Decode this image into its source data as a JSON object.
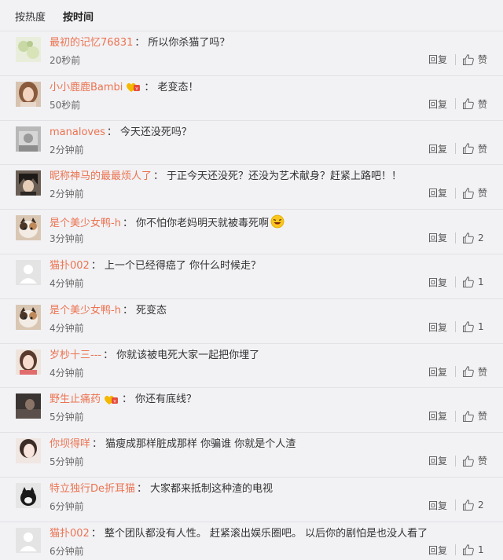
{
  "tabs": [
    {
      "label": "按热度",
      "active": false
    },
    {
      "label": "按时间",
      "active": true
    }
  ],
  "reply_label": "回复",
  "comments": [
    {
      "user": "最初的记忆76831",
      "text": "所以你杀猫了吗？",
      "time": "20秒前",
      "like": "赞",
      "badge": false,
      "emoji": false,
      "avatar": "watercolor"
    },
    {
      "user": "小小鹿鹿Bambi",
      "text": "老变态！",
      "time": "50秒前",
      "like": "赞",
      "badge": true,
      "emoji": false,
      "avatar": "girl-brown-hair"
    },
    {
      "user": "manaloves",
      "text": "今天还没死吗？",
      "time": "2分钟前",
      "like": "赞",
      "badge": false,
      "emoji": false,
      "avatar": "gray-photo"
    },
    {
      "user": "昵称神马的最最烦人了",
      "text": "于正今天还没死？还没为艺术献身？赶紧上路吧！！",
      "time": "2分钟前",
      "like": "赞",
      "badge": false,
      "emoji": false,
      "avatar": "dark-hair-boy"
    },
    {
      "user": "是个美少女鸭-h",
      "text": "你不怕你老妈明天就被毒死啊",
      "time": "3分钟前",
      "like": "2",
      "badge": false,
      "emoji": true,
      "avatar": "cat"
    },
    {
      "user": "猫扑002",
      "text": "上一个已经得癌了  你什么时候走？",
      "time": "4分钟前",
      "like": "1",
      "badge": false,
      "emoji": false,
      "avatar": "default"
    },
    {
      "user": "是个美少女鸭-h",
      "text": "死变态",
      "time": "4分钟前",
      "like": "1",
      "badge": false,
      "emoji": false,
      "avatar": "cat"
    },
    {
      "user": "岁杪十三---",
      "text": "你就该被电死大家一起把你埋了",
      "time": "4分钟前",
      "like": "赞",
      "badge": false,
      "emoji": false,
      "avatar": "girl-light"
    },
    {
      "user": "野生止痛药",
      "text": "你还有底线？",
      "time": "5分钟前",
      "like": "赞",
      "badge": true,
      "emoji": false,
      "avatar": "dark-scene"
    },
    {
      "user": "你坝得咩",
      "text": "猫瘦成那样脏成那样  你骗谁  你就是个人渣",
      "time": "5分钟前",
      "like": "赞",
      "badge": false,
      "emoji": false,
      "avatar": "girl-face"
    },
    {
      "user": "特立独行De折耳猫",
      "text": "大家都来抵制这种渣的电视",
      "time": "6分钟前",
      "like": "2",
      "badge": false,
      "emoji": false,
      "avatar": "black-cat"
    },
    {
      "user": "猫扑002",
      "text": "整个团队都没有人性。  赶紧滚出娱乐圈吧。  以后你的剧怕是也没人看了",
      "time": "6分钟前",
      "like": "1",
      "badge": false,
      "emoji": false,
      "avatar": "default"
    }
  ],
  "colors": {
    "username": "#eb7350",
    "background": "#f2f2f5",
    "text": "#333333"
  }
}
